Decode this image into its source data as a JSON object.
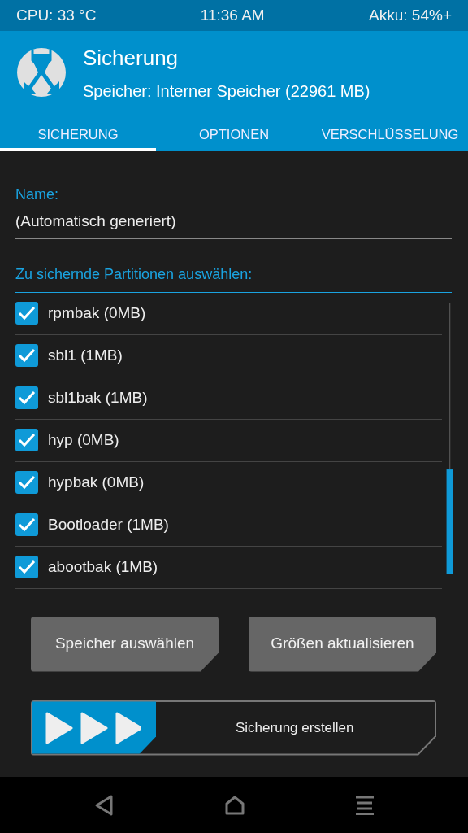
{
  "status_bar": {
    "cpu": "CPU: 33 °C",
    "time": "11:36 AM",
    "battery": "Akku: 54%+"
  },
  "header": {
    "title": "Sicherung",
    "subtitle": "Speicher: Interner Speicher (22961 MB)"
  },
  "tabs": [
    {
      "label": "SICHERUNG",
      "selected": true
    },
    {
      "label": "OPTIONEN",
      "selected": false
    },
    {
      "label": "VERSCHLÜSSELUNG",
      "selected": false
    }
  ],
  "name_field": {
    "label": "Name:",
    "value": "(Automatisch generiert)"
  },
  "partitions": {
    "label": "Zu sichernde Partitionen auswählen:",
    "items": [
      {
        "label": "rpmbak (0MB)",
        "checked": true
      },
      {
        "label": "sbl1 (1MB)",
        "checked": true
      },
      {
        "label": "sbl1bak (1MB)",
        "checked": true
      },
      {
        "label": "hyp (0MB)",
        "checked": true
      },
      {
        "label": "hypbak (0MB)",
        "checked": true
      },
      {
        "label": "Bootloader (1MB)",
        "checked": true
      },
      {
        "label": "abootbak (1MB)",
        "checked": true
      }
    ]
  },
  "buttons": [
    "Speicher auswählen",
    "Größen aktualisieren"
  ],
  "swipe": {
    "label": "Sicherung erstellen",
    "level": 0
  }
}
